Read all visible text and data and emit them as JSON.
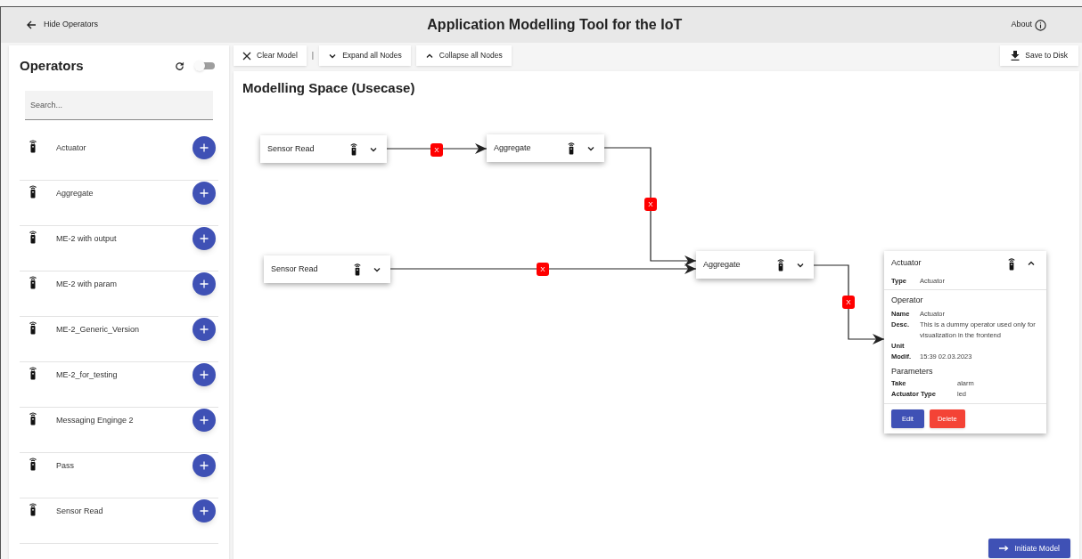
{
  "header": {
    "back_label": "Hide Operators",
    "title": "Application Modelling Tool for the IoT",
    "about_label": "About"
  },
  "sidebar": {
    "title": "Operators",
    "toggle": {
      "on": false
    },
    "search": {
      "placeholder": "Search..."
    },
    "items": [
      {
        "label": "Actuator"
      },
      {
        "label": "Aggregate"
      },
      {
        "label": "ME-2 with output"
      },
      {
        "label": "ME-2 with param"
      },
      {
        "label": "ME-2_Generic_Version"
      },
      {
        "label": "ME-2_for_testing"
      },
      {
        "label": "Messaging Enginge 2"
      },
      {
        "label": "Pass"
      },
      {
        "label": "Sensor Read"
      }
    ]
  },
  "toolbar": {
    "left": [
      {
        "label": "Clear Model"
      },
      {
        "label": "Expand all Nodes"
      },
      {
        "label": "Collapse all Nodes"
      }
    ],
    "separator": "|",
    "save_label": "Save to Disk"
  },
  "canvas": {
    "title": "Modelling Space (Usecase)",
    "nodes": [
      {
        "label": "Sensor Read",
        "expanded": false
      },
      {
        "label": "Aggregate",
        "expanded": false
      },
      {
        "label": "Sensor Read",
        "expanded": false
      },
      {
        "label": "Aggregate",
        "expanded": false
      },
      {
        "label": "Actuator",
        "expanded": true,
        "type_label": "Type",
        "type_value": "Actuator",
        "operator_heading": "Operator",
        "operator_fields": [
          {
            "label": "Name",
            "value": "Actuator"
          },
          {
            "label": "Desc.",
            "value": "This is a dummy operator used only for visualization in the frontend"
          },
          {
            "label": "Unit"
          },
          {
            "label": "Modif.",
            "value": "15:39 02.03.2023"
          }
        ],
        "parameters_heading": "Parameters",
        "parameters": [
          {
            "label": "Take",
            "value": "alarm"
          },
          {
            "label": "Actuator Type",
            "value": "led"
          }
        ],
        "edit_label": "Edit",
        "delete_label": "Delete"
      }
    ],
    "edges": [
      {
        "remove_label": "X"
      },
      {
        "remove_label": "X"
      },
      {
        "remove_label": "X"
      },
      {
        "remove_label": "X"
      }
    ],
    "initiate_label": "Initiate Model"
  }
}
